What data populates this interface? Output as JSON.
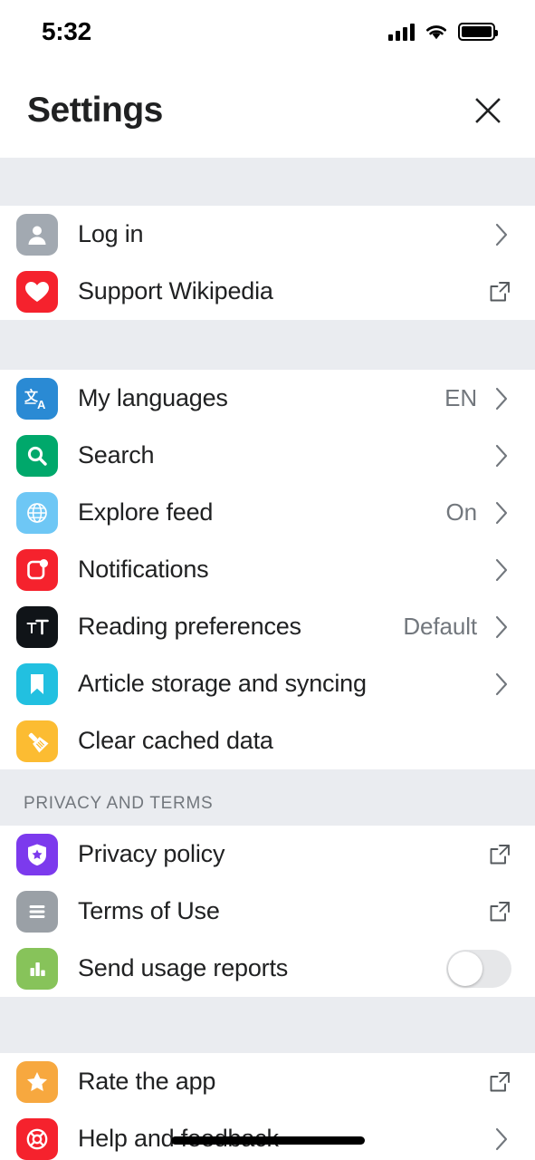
{
  "status_bar": {
    "time": "5:32",
    "cellular_icon": "signal-bars-icon",
    "wifi_icon": "wifi-icon",
    "battery_icon": "battery-full-icon"
  },
  "navbar": {
    "title": "Settings",
    "close_icon": "close-icon"
  },
  "sections": [
    {
      "header": null,
      "rows": [
        {
          "label": "Log in",
          "icon": "user-icon",
          "icon_color": "#a2a9b1",
          "accessory": "chevron",
          "value": ""
        },
        {
          "label": "Support Wikipedia",
          "icon": "heart-icon",
          "icon_color": "#f5222d",
          "accessory": "external-link",
          "value": ""
        }
      ]
    },
    {
      "header": null,
      "rows": [
        {
          "label": "My languages",
          "icon": "translate-icon",
          "icon_color": "#2a8ad4",
          "accessory": "chevron",
          "value": "EN"
        },
        {
          "label": "Search",
          "icon": "search-icon",
          "icon_color": "#00a86b",
          "accessory": "chevron",
          "value": ""
        },
        {
          "label": "Explore feed",
          "icon": "globe-icon",
          "icon_color": "#6ec7f5",
          "accessory": "chevron",
          "value": "On"
        },
        {
          "label": "Notifications",
          "icon": "bell-badge-icon",
          "icon_color": "#f5222d",
          "accessory": "chevron",
          "value": ""
        },
        {
          "label": "Reading preferences",
          "icon": "text-size-icon",
          "icon_color": "#101418",
          "accessory": "chevron",
          "value": "Default"
        },
        {
          "label": "Article storage and syncing",
          "icon": "bookmark-icon",
          "icon_color": "#22c0e0",
          "accessory": "chevron",
          "value": ""
        },
        {
          "label": "Clear cached data",
          "icon": "broom-icon",
          "icon_color": "#fcbc32",
          "accessory": "none",
          "value": ""
        }
      ]
    },
    {
      "header": "PRIVACY AND TERMS",
      "rows": [
        {
          "label": "Privacy policy",
          "icon": "shield-star-icon",
          "icon_color": "#7c3aed",
          "accessory": "external-link",
          "value": ""
        },
        {
          "label": "Terms of Use",
          "icon": "document-lines-icon",
          "icon_color": "#9aa0a6",
          "accessory": "external-link",
          "value": ""
        },
        {
          "label": "Send usage reports",
          "icon": "bar-chart-icon",
          "icon_color": "#87c35a",
          "accessory": "toggle",
          "value": "",
          "toggle_on": false
        }
      ]
    },
    {
      "header": null,
      "rows": [
        {
          "label": "Rate the app",
          "icon": "star-icon",
          "icon_color": "#f7a83f",
          "accessory": "external-link",
          "value": ""
        },
        {
          "label": "Help and feedback",
          "icon": "lifebuoy-icon",
          "icon_color": "#f5222d",
          "accessory": "chevron",
          "value": ""
        }
      ]
    }
  ],
  "home_indicator": "home-indicator"
}
